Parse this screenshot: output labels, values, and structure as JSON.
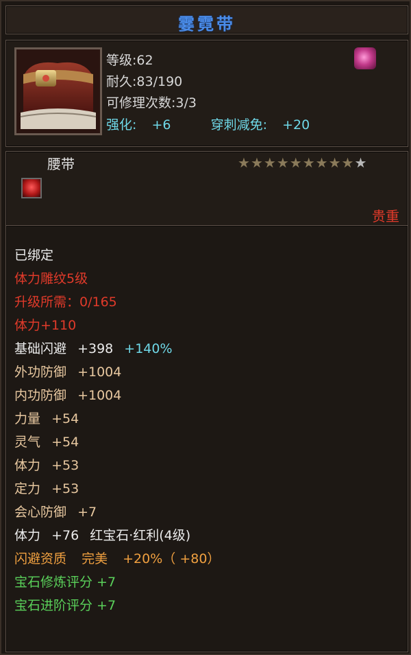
{
  "item": {
    "name": "霎霓带",
    "level_text": "等级:62",
    "durability_text": "耐久:83/190",
    "repair_text": "可修理次数:3/3",
    "enhance_label": "强化:",
    "enhance_value": "+6",
    "pierce_label": "穿刺减免:",
    "pierce_value": "+20",
    "type": "腰带",
    "rarity": "贵重",
    "stars_filled": 9,
    "stars_total": 10,
    "icons": [
      "belt-portrait",
      "equip-badge-icon",
      "ruby-gem-icon",
      "star-icon"
    ]
  },
  "attributes": {
    "bound": "已绑定",
    "engrave": "体力雕纹5级",
    "upgrade_req": "升级所需：0/165",
    "vit_bonus": "体力+110",
    "dodge_label": "基础闪避",
    "dodge_value": "+398",
    "dodge_pct": "+140%",
    "ext_def_label": "外功防御",
    "ext_def_value": "+1004",
    "int_def_label": "内功防御",
    "int_def_value": "+1004",
    "str_label": "力量",
    "str_value": "+54",
    "spirit_label": "灵气",
    "spirit_value": "+54",
    "vit_label": "体力",
    "vit_value": "+53",
    "focus_label": "定力",
    "focus_value": "+53",
    "crit_def_label": "会心防御",
    "crit_def_value": "+7",
    "gem_stat_label": "体力",
    "gem_stat_value": "+76",
    "gem_name": "红宝石·红利(4级)",
    "quality_label": "闪避资质",
    "quality_grade": "完美",
    "quality_value": "+20%（ +80）",
    "gem_refine": "宝石修炼评分 +7",
    "gem_advance": "宝石进阶评分 +7"
  },
  "colors": {
    "title": "#4a8ce8",
    "red": "#e03a2a",
    "cyan": "#6fd8e8",
    "tan": "#e8c8a0",
    "orange": "#f0a040",
    "green": "#5ad05a"
  }
}
